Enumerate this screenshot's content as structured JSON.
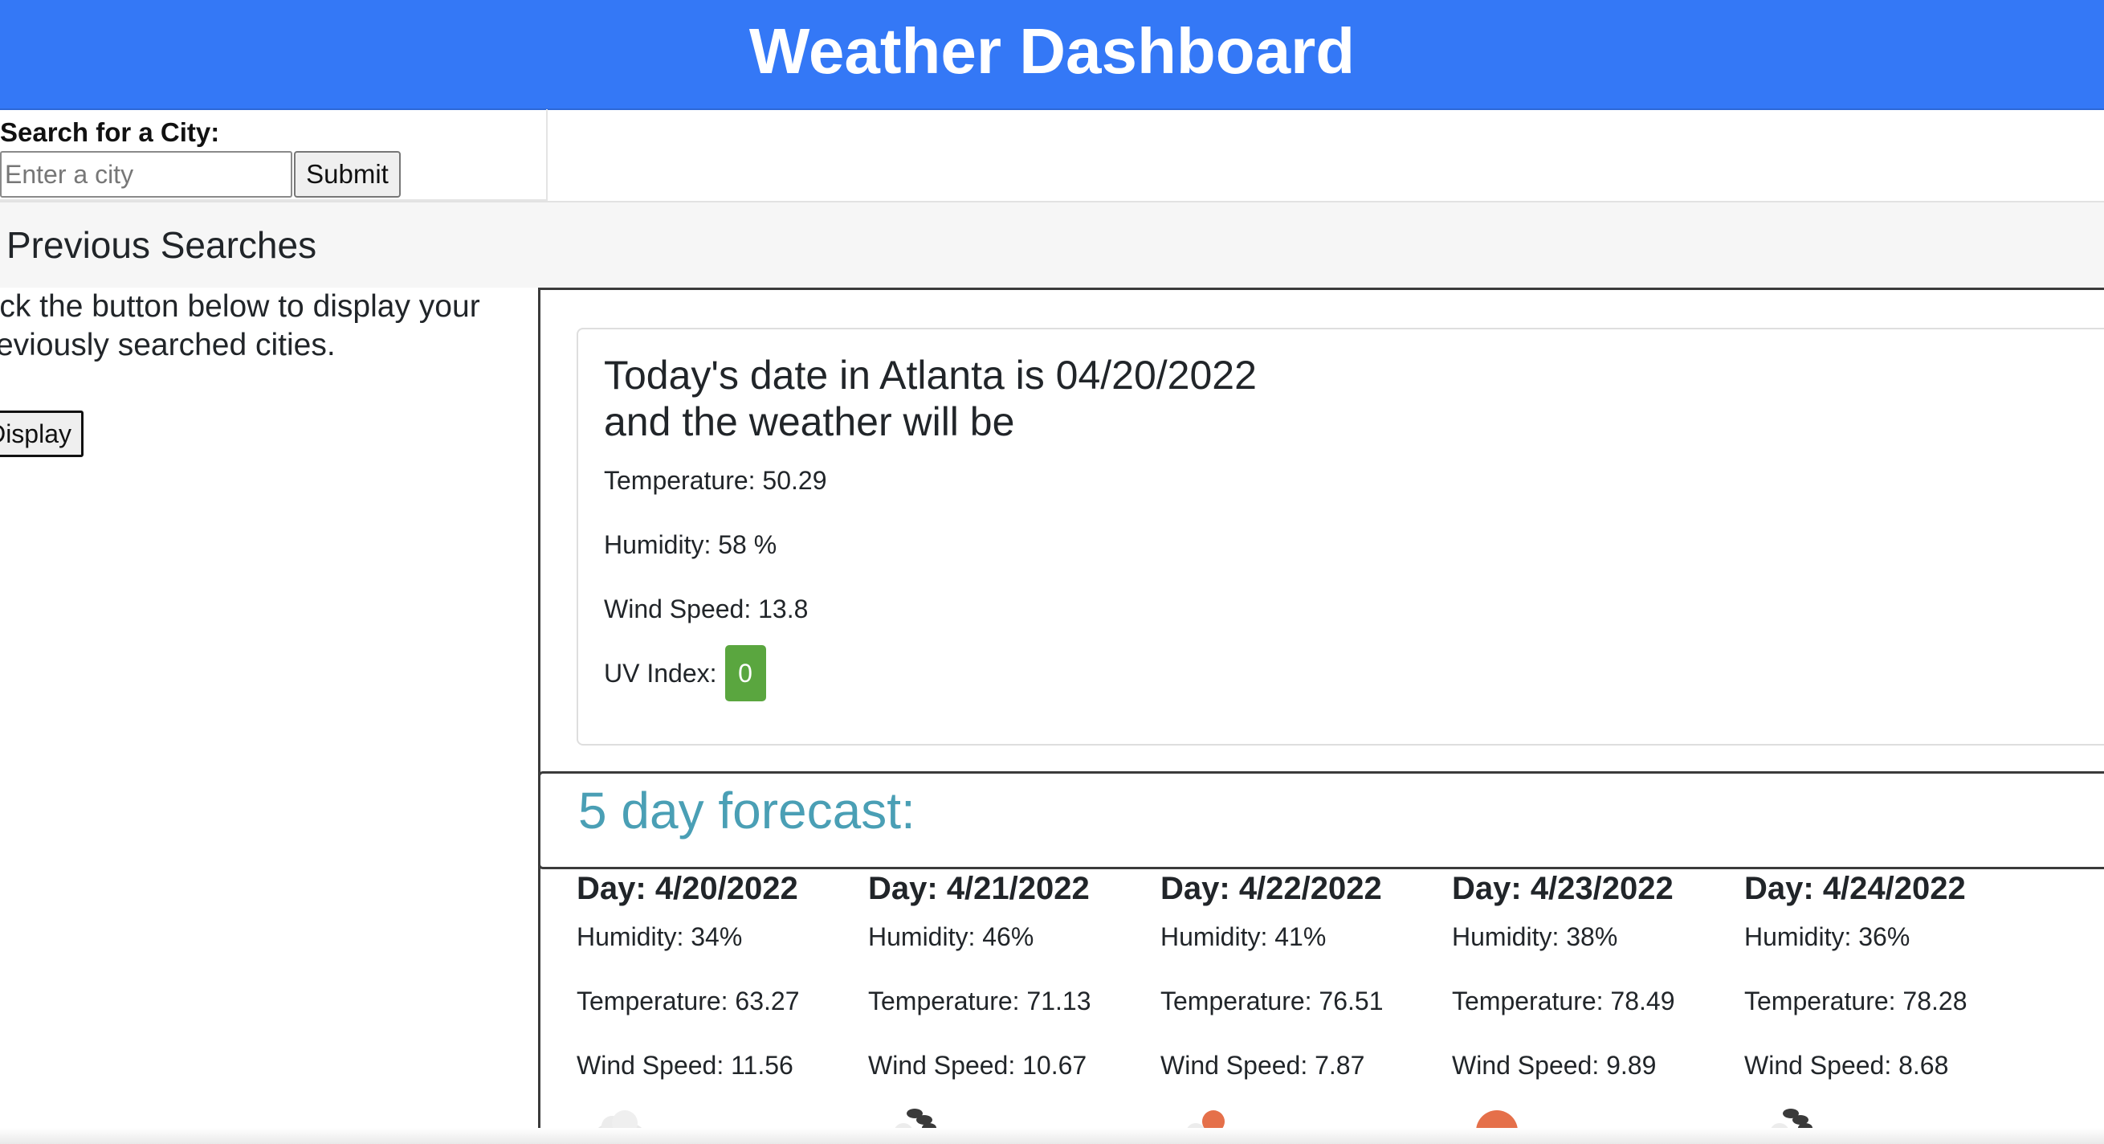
{
  "header": {
    "title": "Weather Dashboard"
  },
  "search": {
    "label": "Search for a City:",
    "placeholder": "Enter a city",
    "value": "",
    "submit_label": "Submit"
  },
  "previous": {
    "title": "Previous Searches",
    "description": "lick the button below to display your reviously searched cities.",
    "display_label": "Display"
  },
  "today": {
    "heading_line1": "Today's date in Atlanta is 04/20/2022",
    "heading_line2": "and the weather will be",
    "temperature": "Temperature: 50.29",
    "humidity": "Humidity: 58 %",
    "wind": "Wind Speed: 13.8",
    "uv_label": "UV Index:",
    "uv_value": "0",
    "uv_color": "#5aa63f"
  },
  "forecast": {
    "title": "5 day forecast:",
    "title_color": "#4a9fb5",
    "days": [
      {
        "day": "Day: 4/20/2022",
        "humidity": "Humidity: 34%",
        "temperature": "Temperature: 63.27",
        "wind": "Wind Speed: 11.56",
        "icon": "cloud-icon"
      },
      {
        "day": "Day: 4/21/2022",
        "humidity": "Humidity: 46%",
        "temperature": "Temperature: 71.13",
        "wind": "Wind Speed: 10.67",
        "icon": "rain-cloud-icon"
      },
      {
        "day": "Day: 4/22/2022",
        "humidity": "Humidity: 41%",
        "temperature": "Temperature: 76.51",
        "wind": "Wind Speed: 7.87",
        "icon": "partly-cloudy-icon"
      },
      {
        "day": "Day: 4/23/2022",
        "humidity": "Humidity: 38%",
        "temperature": "Temperature: 78.49",
        "wind": "Wind Speed: 9.89",
        "icon": "sun-icon"
      },
      {
        "day": "Day: 4/24/2022",
        "humidity": "Humidity: 36%",
        "temperature": "Temperature: 78.28",
        "wind": "Wind Speed: 8.68",
        "icon": "rain-cloud-icon"
      }
    ]
  },
  "colors": {
    "header_bg": "#3478f6"
  }
}
